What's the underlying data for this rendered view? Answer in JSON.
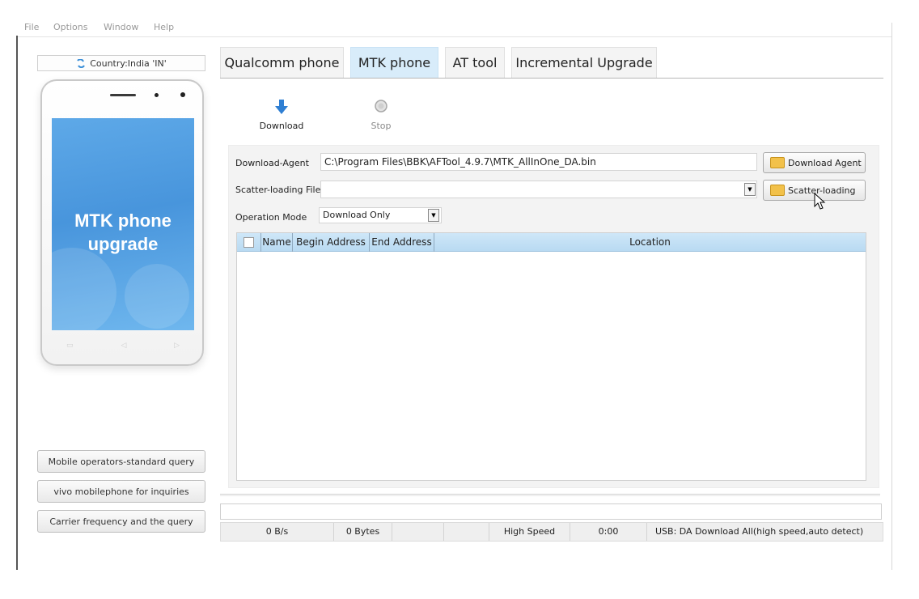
{
  "menu": [
    "File",
    "Options",
    "Window",
    "Help"
  ],
  "country": {
    "label": "Country:India 'IN'"
  },
  "phone": {
    "screen_text_line1": "MTK phone",
    "screen_text_line2": "upgrade",
    "softkeys": [
      "▭",
      "◁",
      "▷"
    ]
  },
  "side_buttons": [
    "Mobile operators-standard query",
    "vivo mobilephone for inquiries",
    "Carrier frequency and the query"
  ],
  "tabs": [
    {
      "label": "Qualcomm phone"
    },
    {
      "label": "MTK phone",
      "active": true
    },
    {
      "label": "AT tool"
    },
    {
      "label": "Incremental Upgrade"
    }
  ],
  "toolbar": {
    "download_label": "Download",
    "download_icon": "down-arrow-icon",
    "stop_label": "Stop",
    "stop_icon": "stop-icon"
  },
  "form": {
    "download_agent_label": "Download-Agent",
    "download_agent_value": "C:\\Program Files\\BBK\\AFTool_4.9.7\\MTK_AllInOne_DA.bin",
    "download_agent_button": "Download Agent",
    "scatter_label": "Scatter-loading File",
    "scatter_value": "",
    "scatter_button": "Scatter-loading",
    "mode_label": "Operation Mode",
    "mode_value": "Download Only"
  },
  "table": {
    "columns": [
      "Name",
      "Begin Address",
      "End Address",
      "Location"
    ],
    "rows": []
  },
  "status": {
    "speed": "0 B/s",
    "bytes": "0 Bytes",
    "blank1": "",
    "blank2": "",
    "mode": "High Speed",
    "time": "0:00",
    "usb": "USB: DA Download All(high speed,auto detect)"
  },
  "colors": {
    "accent": "#4a95dc",
    "active_tab": "#d8ecfa",
    "table_header": "#c4e0f5",
    "folder": "#f2c14a"
  }
}
